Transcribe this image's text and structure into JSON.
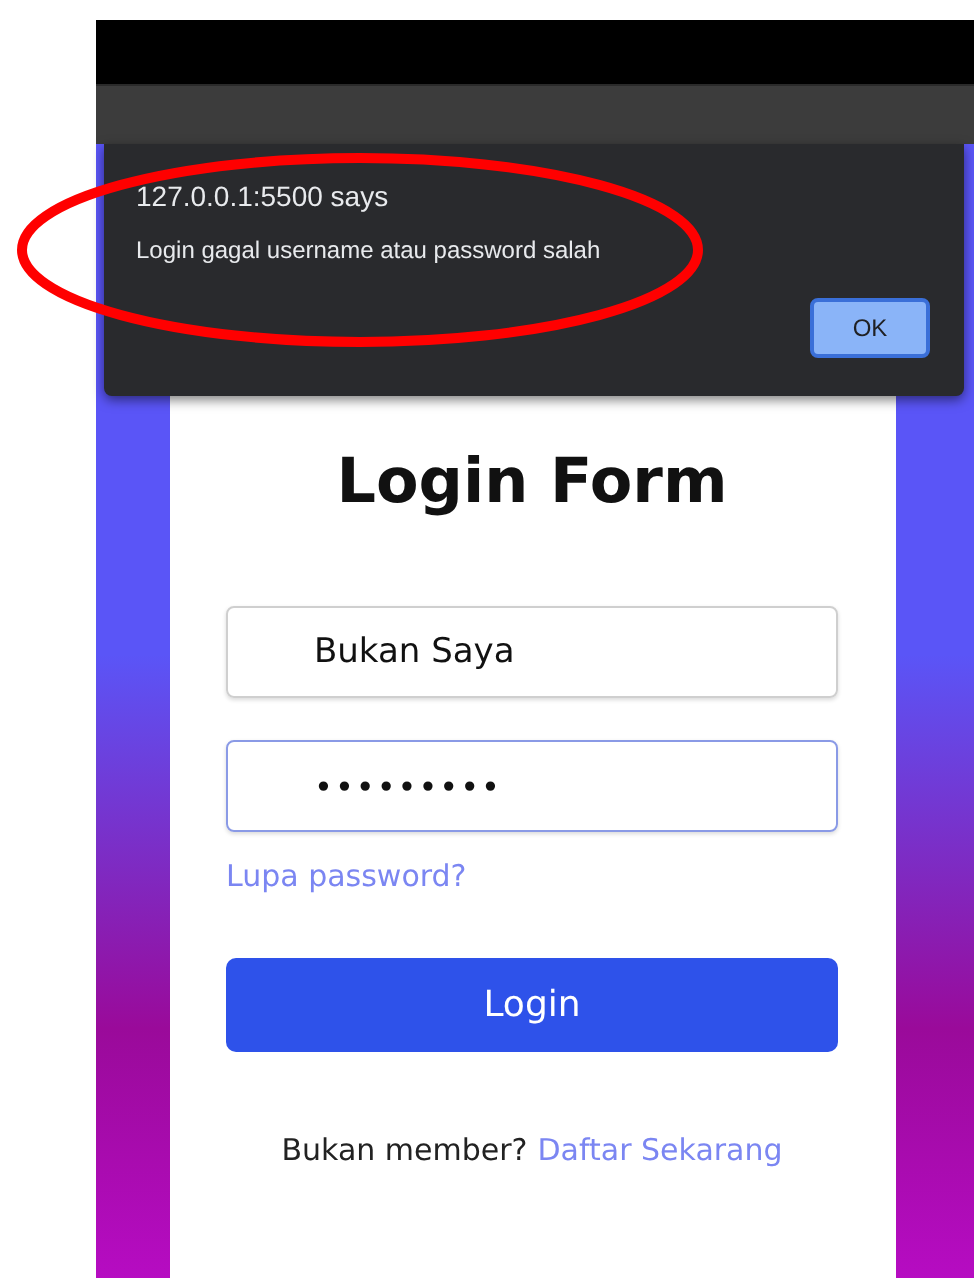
{
  "dialog": {
    "origin": "127.0.0.1:5500 says",
    "message": "Login gagal username atau password salah",
    "button": "OK"
  },
  "form": {
    "title": "Login Form",
    "fields": [
      {
        "kind": "text",
        "value": "Bukan Saya",
        "focused": false
      },
      {
        "kind": "password",
        "value": "•••••••••",
        "focused": true
      }
    ],
    "forgot_link": "Lupa password?",
    "login_button": "Login",
    "footer_text": "Bukan member?",
    "footer_link": "Daftar Sekarang"
  },
  "annotation": {
    "kind": "ellipse"
  }
}
